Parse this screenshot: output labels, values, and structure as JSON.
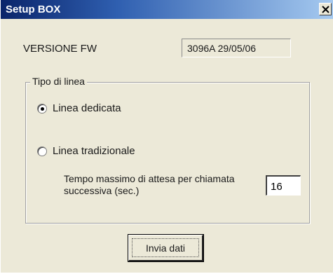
{
  "window": {
    "title": "Setup BOX",
    "close_icon": "close-icon"
  },
  "version": {
    "label": "VERSIONE FW",
    "value": "3096A 29/05/06"
  },
  "line_type": {
    "legend": "Tipo di linea",
    "options": [
      {
        "label": "Linea dedicata",
        "checked": true
      },
      {
        "label": "Linea tradizionale",
        "checked": false
      }
    ],
    "wait_label": "Tempo massimo di attesa per chiamata successiva (sec.)",
    "wait_value": "16"
  },
  "actions": {
    "send_label": "Invia dati"
  }
}
